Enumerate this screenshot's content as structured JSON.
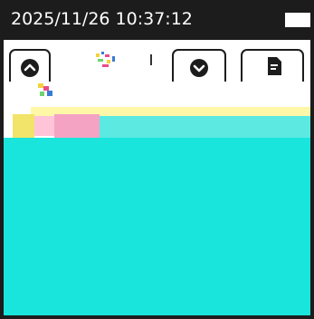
{
  "status_bar": {
    "datetime": "2025/11/26 10:37:12",
    "battery_icon": "battery-full-icon"
  },
  "toolbar": {
    "buttons": [
      {
        "icon": "chevron-up-circle-icon"
      },
      {
        "icon": "chevron-down-circle-icon"
      },
      {
        "icon": "document-icon"
      }
    ]
  },
  "colors": {
    "frame": "#1c1c1c",
    "cyan_area": "#1ae5dc",
    "glitch_yellow": "#fff7a8",
    "glitch_pink": "#f4a3c3"
  }
}
